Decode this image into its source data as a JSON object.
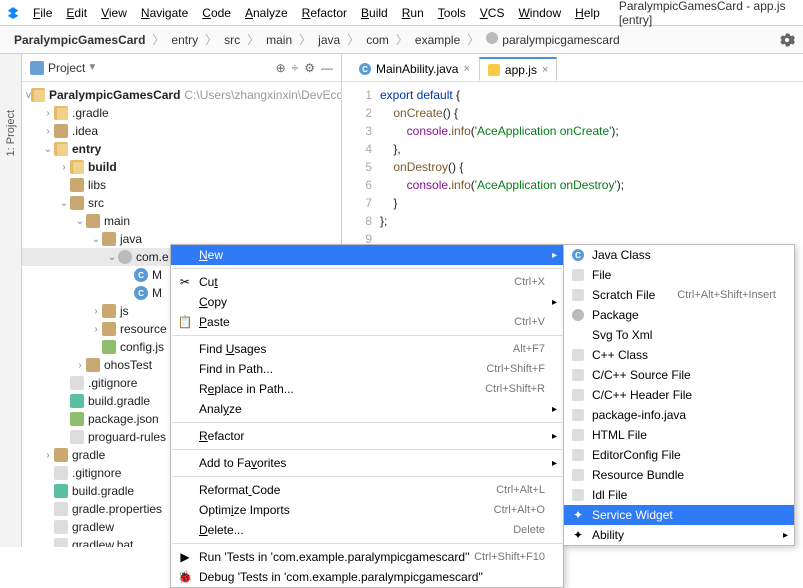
{
  "window_title": "ParalympicGamesCard - app.js [entry]",
  "menu": [
    "File",
    "Edit",
    "View",
    "Navigate",
    "Code",
    "Analyze",
    "Refactor",
    "Build",
    "Run",
    "Tools",
    "VCS",
    "Window",
    "Help"
  ],
  "breadcrumbs": [
    "ParalympicGamesCard",
    "entry",
    "src",
    "main",
    "java",
    "com",
    "example",
    "paralympicgamescard"
  ],
  "project_panel": {
    "title": "Project"
  },
  "sidebar_tab": "1: Project",
  "tree": {
    "root": {
      "name": "ParalympicGamesCard",
      "hint": "C:\\Users\\zhangxinxin\\DevEcoSt"
    },
    "items": [
      {
        "d": 1,
        "tw": ">",
        "ic": "diro",
        "lbl": ".gradle"
      },
      {
        "d": 1,
        "tw": ">",
        "ic": "dir",
        "lbl": ".idea"
      },
      {
        "d": 1,
        "tw": "v",
        "ic": "diro",
        "lbl": "entry",
        "bold": true
      },
      {
        "d": 2,
        "tw": ">",
        "ic": "diro",
        "lbl": "build",
        "bold": true
      },
      {
        "d": 2,
        "tw": "",
        "ic": "dir",
        "lbl": "libs"
      },
      {
        "d": 2,
        "tw": "v",
        "ic": "dir",
        "lbl": "src"
      },
      {
        "d": 3,
        "tw": "v",
        "ic": "dir",
        "lbl": "main"
      },
      {
        "d": 4,
        "tw": "v",
        "ic": "dir",
        "lbl": "java"
      },
      {
        "d": 5,
        "tw": "v",
        "ic": "pkg",
        "lbl": "com.e",
        "sel": true
      },
      {
        "d": 6,
        "tw": "",
        "ic": "cls",
        "lbl": "M"
      },
      {
        "d": 6,
        "tw": "",
        "ic": "cls",
        "lbl": "M"
      },
      {
        "d": 4,
        "tw": ">",
        "ic": "dir",
        "lbl": "js"
      },
      {
        "d": 4,
        "tw": ">",
        "ic": "dir",
        "lbl": "resource"
      },
      {
        "d": 4,
        "tw": "",
        "ic": "json",
        "lbl": "config.js"
      },
      {
        "d": 3,
        "tw": ">",
        "ic": "dir",
        "lbl": "ohosTest"
      },
      {
        "d": 2,
        "tw": "",
        "ic": "file",
        "lbl": ".gitignore"
      },
      {
        "d": 2,
        "tw": "",
        "ic": "gradle",
        "lbl": "build.gradle"
      },
      {
        "d": 2,
        "tw": "",
        "ic": "json",
        "lbl": "package.json"
      },
      {
        "d": 2,
        "tw": "",
        "ic": "file",
        "lbl": "proguard-rules"
      },
      {
        "d": 1,
        "tw": ">",
        "ic": "dir",
        "lbl": "gradle"
      },
      {
        "d": 1,
        "tw": "",
        "ic": "file",
        "lbl": ".gitignore"
      },
      {
        "d": 1,
        "tw": "",
        "ic": "gradle",
        "lbl": "build.gradle"
      },
      {
        "d": 1,
        "tw": "",
        "ic": "file",
        "lbl": "gradle.properties"
      },
      {
        "d": 1,
        "tw": "",
        "ic": "file",
        "lbl": "gradlew"
      },
      {
        "d": 1,
        "tw": "",
        "ic": "file",
        "lbl": "gradlew.bat"
      }
    ]
  },
  "tabs": [
    {
      "label": "MainAbility.java",
      "ic": "cls"
    },
    {
      "label": "app.js",
      "ic": "js",
      "active": true
    }
  ],
  "code": [
    [
      [
        "kw",
        "export default"
      ],
      [
        "br",
        " {"
      ]
    ],
    [
      [
        "sp",
        "    "
      ],
      [
        "fn",
        "onCreate"
      ],
      [
        "br",
        "() {"
      ]
    ],
    [
      [
        "sp",
        "        "
      ],
      [
        "id",
        "console"
      ],
      [
        "br",
        "."
      ],
      [
        "fn",
        "info"
      ],
      [
        "br",
        "("
      ],
      [
        "str",
        "'AceApplication onCreate'"
      ],
      [
        "br",
        ");"
      ]
    ],
    [
      [
        "sp",
        "    "
      ],
      [
        "br",
        "},"
      ]
    ],
    [
      [
        "sp",
        "    "
      ],
      [
        "fn",
        "onDestroy"
      ],
      [
        "br",
        "() {"
      ]
    ],
    [
      [
        "sp",
        "        "
      ],
      [
        "id",
        "console"
      ],
      [
        "br",
        "."
      ],
      [
        "fn",
        "info"
      ],
      [
        "br",
        "("
      ],
      [
        "str",
        "'AceApplication onDestroy'"
      ],
      [
        "br",
        ");"
      ]
    ],
    [
      [
        "sp",
        "    "
      ],
      [
        "br",
        "}"
      ]
    ],
    [
      [
        "br",
        "};"
      ]
    ],
    []
  ],
  "context_menu": [
    {
      "lbl": "New",
      "u": 0,
      "arrow": true,
      "sel": true
    },
    {
      "sep": true
    },
    {
      "lbl": "Cut",
      "u": 2,
      "sc": "Ctrl+X",
      "icon": "cut"
    },
    {
      "lbl": "Copy",
      "u": 0,
      "arrow": true
    },
    {
      "lbl": "Paste",
      "u": 0,
      "sc": "Ctrl+V",
      "icon": "paste"
    },
    {
      "sep": true
    },
    {
      "lbl": "Find Usages",
      "u": 5,
      "sc": "Alt+F7"
    },
    {
      "lbl": "Find in Path...",
      "sc": "Ctrl+Shift+F"
    },
    {
      "lbl": "Replace in Path...",
      "u": 1,
      "sc": "Ctrl+Shift+R"
    },
    {
      "lbl": "Analyze",
      "u": 4,
      "arrow": true
    },
    {
      "sep": true
    },
    {
      "lbl": "Refactor",
      "u": 0,
      "arrow": true
    },
    {
      "sep": true
    },
    {
      "lbl": "Add to Favorites",
      "u": 9,
      "arrow": true
    },
    {
      "sep": true
    },
    {
      "lbl": "Reformat Code",
      "u": 8,
      "sc": "Ctrl+Alt+L"
    },
    {
      "lbl": "Optimize Imports",
      "u": 5,
      "sc": "Ctrl+Alt+O"
    },
    {
      "lbl": "Delete...",
      "u": 0,
      "sc": "Delete"
    },
    {
      "sep": true
    },
    {
      "lbl": "Run 'Tests in 'com.example.paralympicgamescard''",
      "sc": "Ctrl+Shift+F10",
      "icon": "run"
    },
    {
      "lbl": "Debug 'Tests in 'com.example.paralympicgamescard''",
      "icon": "debug"
    }
  ],
  "submenu": [
    {
      "lbl": "Java Class",
      "icon": "cls"
    },
    {
      "lbl": "File",
      "icon": "file"
    },
    {
      "lbl": "Scratch File",
      "sc": "Ctrl+Alt+Shift+Insert",
      "icon": "file"
    },
    {
      "lbl": "Package",
      "icon": "pkg"
    },
    {
      "lbl": "Svg To Xml"
    },
    {
      "lbl": "C++ Class",
      "icon": "file"
    },
    {
      "lbl": "C/C++ Source File",
      "icon": "file"
    },
    {
      "lbl": "C/C++ Header File",
      "icon": "file"
    },
    {
      "lbl": "package-info.java",
      "icon": "file"
    },
    {
      "lbl": "HTML File",
      "icon": "file"
    },
    {
      "lbl": "EditorConfig File",
      "icon": "file"
    },
    {
      "lbl": "Resource Bundle",
      "icon": "file"
    },
    {
      "lbl": "Idl File",
      "icon": "file"
    },
    {
      "lbl": "Service Widget",
      "icon": "widget",
      "sel": true
    },
    {
      "lbl": "Ability",
      "icon": "widget",
      "arrow": true
    }
  ]
}
